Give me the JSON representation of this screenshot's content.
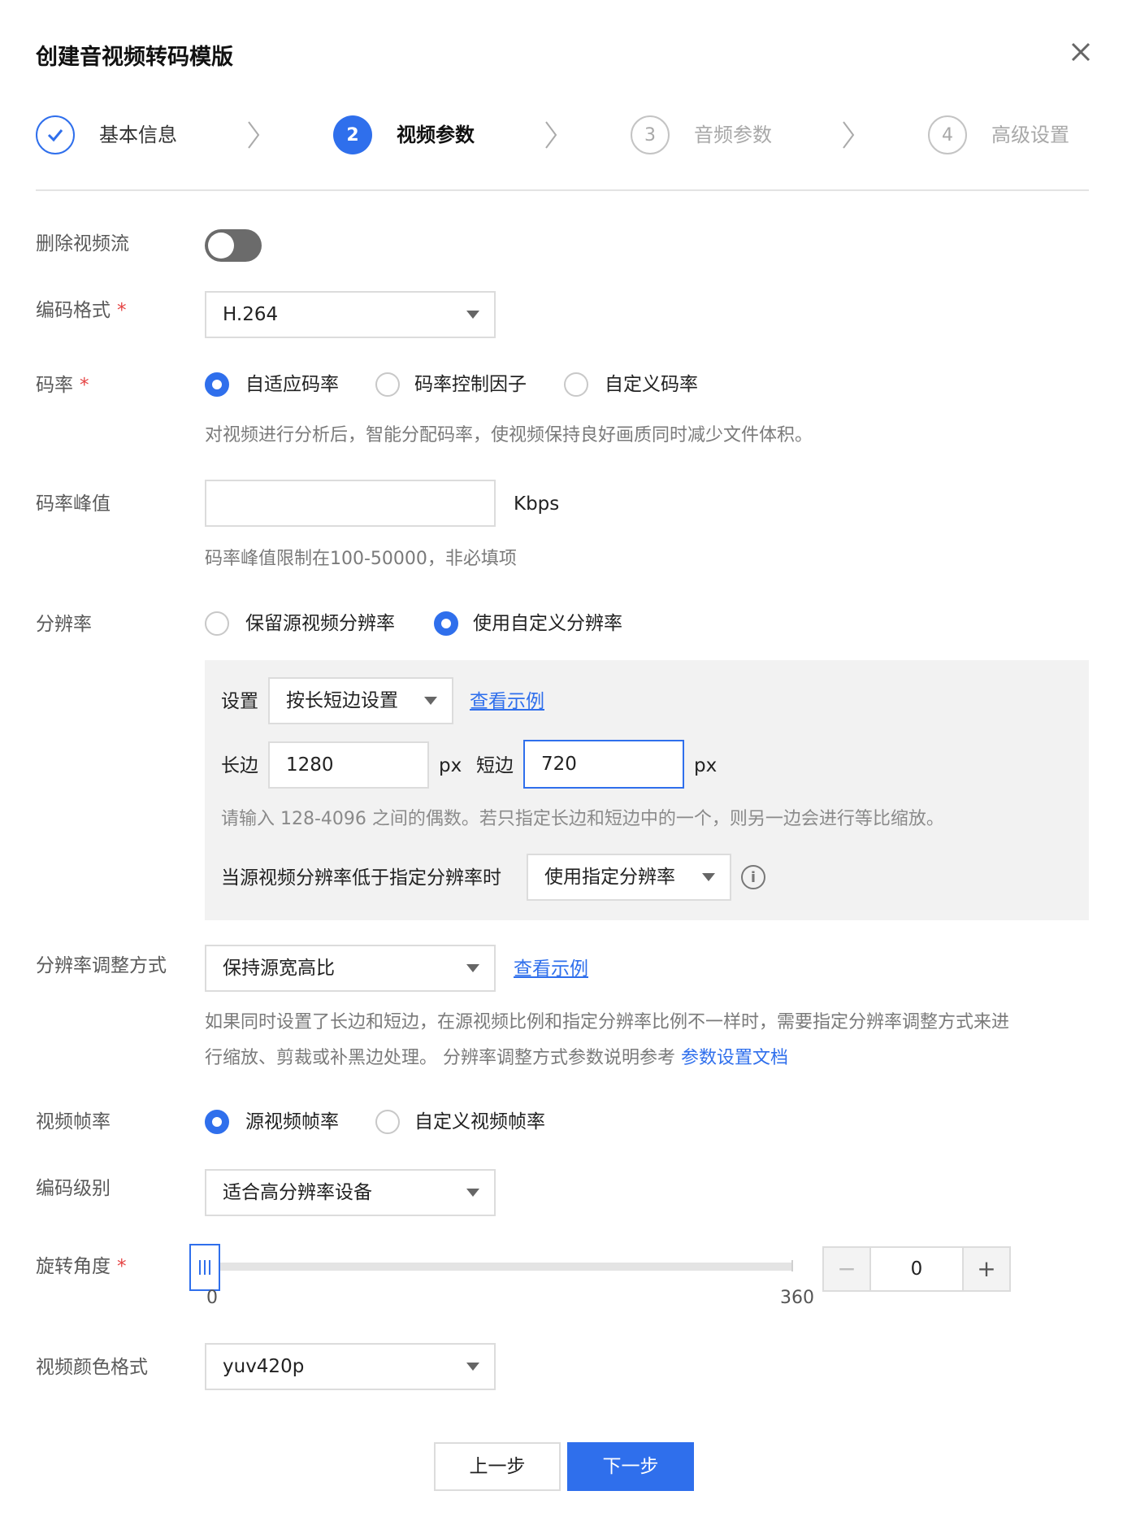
{
  "dialog": {
    "title": "创建音视频转码模版",
    "close_icon": "close-icon"
  },
  "steps": [
    {
      "index": "1",
      "label": "基本信息",
      "state": "done",
      "icon": "check-icon"
    },
    {
      "index": "2",
      "label": "视频参数",
      "state": "active"
    },
    {
      "index": "3",
      "label": "音频参数",
      "state": "todo"
    },
    {
      "index": "4",
      "label": "高级设置",
      "state": "todo"
    }
  ],
  "remove_video_stream": {
    "label": "删除视频流",
    "enabled": false
  },
  "codec": {
    "label": "编码格式",
    "required_mark": "*",
    "value": "H.264"
  },
  "bitrate": {
    "label": "码率",
    "required_mark": "*",
    "options": [
      "自适应码率",
      "码率控制因子",
      "自定义码率"
    ],
    "selected": "自适应码率",
    "hint": "对视频进行分析后，智能分配码率，使视频保持良好画质同时减少文件体积。"
  },
  "peak_bitrate": {
    "label": "码率峰值",
    "value": "",
    "unit": "Kbps",
    "hint": "码率峰值限制在100-50000，非必填项"
  },
  "resolution": {
    "label": "分辨率",
    "options": [
      "保留源视频分辨率",
      "使用自定义分辨率"
    ],
    "selected": "使用自定义分辨率",
    "setting_label": "设置",
    "setting_value": "按长短边设置",
    "example_link": "查看示例",
    "long_side_label": "长边",
    "long_side_value": "1280",
    "short_side_label": "短边",
    "short_side_value": "720",
    "unit": "px",
    "hint": "请输入 128-4096 之间的偶数。若只指定长边和短边中的一个，则另一边会进行等比缩放。",
    "lower_label": "当源视频分辨率低于指定分辨率时",
    "lower_value": "使用指定分辨率",
    "info_icon": "info-icon"
  },
  "resize_mode": {
    "label": "分辨率调整方式",
    "value": "保持源宽高比",
    "example_link": "查看示例",
    "hint_line1": "如果同时设置了长边和短边，在源视频比例和指定分辨率比例不一样时，需要指定分辨率调整方式来进",
    "hint_line2": "行缩放、剪裁或补黑边处理。 分辨率调整方式参数说明参考 ",
    "hint_link": "参数设置文档"
  },
  "frame_rate": {
    "label": "视频帧率",
    "options": [
      "源视频帧率",
      "自定义视频帧率"
    ],
    "selected": "源视频帧率"
  },
  "profile": {
    "label": "编码级别",
    "value": "适合高分辨率设备"
  },
  "rotation": {
    "label": "旋转角度",
    "required_mark": "*",
    "min_label": "0",
    "max_label": "360",
    "value": "0",
    "minus": "−",
    "plus": "+"
  },
  "pixel_format": {
    "label": "视频颜色格式",
    "value": "yuv420p"
  },
  "footer": {
    "prev": "上一步",
    "next": "下一步"
  },
  "colors": {
    "primary": "#2f6fec",
    "required": "#e54545"
  }
}
